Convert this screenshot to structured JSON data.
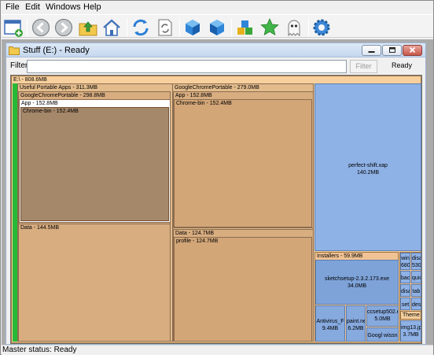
{
  "menu": {
    "file": "File",
    "edit": "Edit",
    "windows": "Windows",
    "help": "Help"
  },
  "toolbar": {
    "buttons": [
      "new-window-icon",
      "back-arrow-icon",
      "forward-arrow-icon",
      "folder-up-icon",
      "home-icon",
      "refresh-icon",
      "refresh-document-icon",
      "cube-icon",
      "cube-left-icon",
      "blocks-icon",
      "star-icon",
      "ghost-icon",
      "settings-gear-icon"
    ]
  },
  "child_window": {
    "title": "Stuff (E:) - Ready",
    "filter_label": "Filter",
    "filter_value": "",
    "filter_button": "Filter",
    "status": "Ready"
  },
  "treemap": {
    "root": "E:\\ - 808.6MB",
    "useful": "Useful Portable Apps - 311.3MB",
    "gcp_left": "GoogleChromePortable - 298.8MB",
    "app_left": "App - 152.8MB",
    "chrome_left": "Chrome-bin - 152.4MB",
    "data_left": "Data - 144.5MB",
    "gcp_right": "GoogleChromePortable - 279.0MB",
    "app_right": "App - 152.8MB",
    "chrome_right": "Chrome-bin - 152.4MB",
    "data_right": "Data - 124.7MB",
    "profile": "profile - 124.7MB",
    "perfect_name": "perfect-shift.xap",
    "perfect_size": "140.2MB",
    "installers": "Installers - 59.9MB",
    "sketch_name": "sketchsetup-2.3.2.173.exe",
    "sketch_size": "34.0MB",
    "antivirus_name": "Antivirus_F",
    "antivirus_size": "9.4MB",
    "paint_name": "paint.ne",
    "paint_size": "6.2MB",
    "ccsetup_name": "ccsetup502.e",
    "ccsetup_size": "5.0MB",
    "google_cut": "Googl wissn",
    "small_a1": "win",
    "small_a2": "680",
    "small_b1": "disa",
    "small_b2": "530",
    "small_c": "bac",
    "small_d": "quic",
    "small_e": "disa",
    "small_f": "tab",
    "small_g": "set",
    "small_h": "des",
    "theme": "Theme1",
    "img_name": "img13.jp",
    "img_size": "3.7MB"
  },
  "status": {
    "text": "Master status: Ready"
  }
}
